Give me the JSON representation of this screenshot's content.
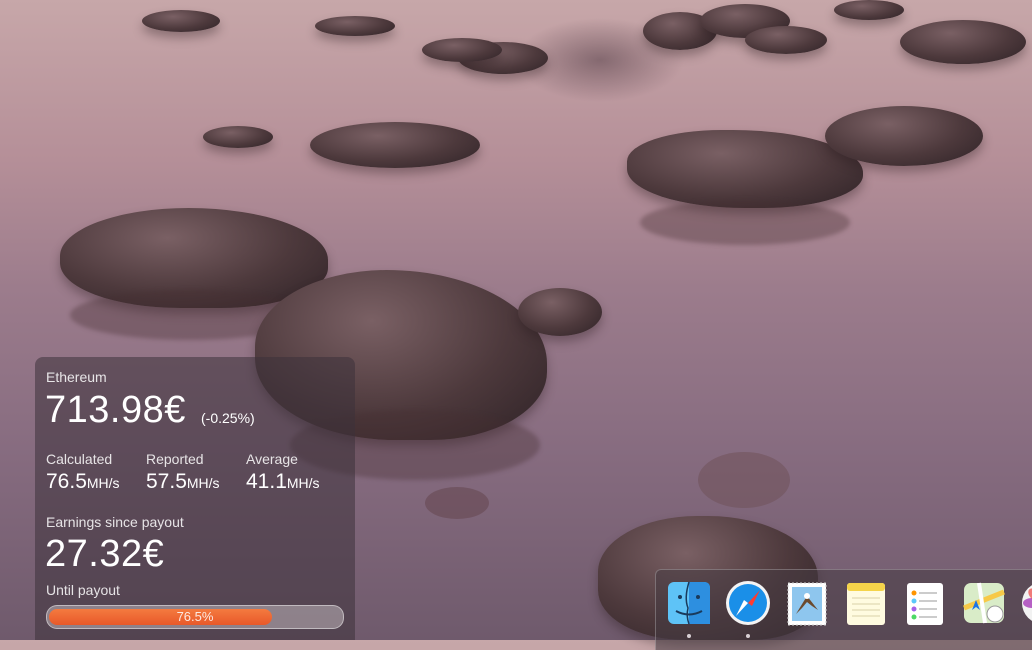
{
  "widget": {
    "coin_name": "Ethereum",
    "price": "713.98€",
    "price_change": "(-0.25%)",
    "metrics": [
      {
        "label": "Calculated",
        "value": "76.5",
        "unit": "MH/s"
      },
      {
        "label": "Reported",
        "value": "57.5",
        "unit": "MH/s"
      },
      {
        "label": "Average",
        "value": "41.1",
        "unit": "MH/s"
      }
    ],
    "earnings_label": "Earnings since payout",
    "earnings_value": "27.32€",
    "payout_label": "Until payout",
    "payout_progress_text": "76.5%",
    "payout_progress": 0.765
  },
  "dock": {
    "items": [
      {
        "name": "Finder",
        "icon": "finder-icon",
        "running": true
      },
      {
        "name": "Safari",
        "icon": "safari-icon",
        "running": true
      },
      {
        "name": "Mail",
        "icon": "mail-icon",
        "running": false
      },
      {
        "name": "Notes",
        "icon": "notes-icon",
        "running": false
      },
      {
        "name": "Reminders",
        "icon": "reminders-icon",
        "running": false
      },
      {
        "name": "Maps",
        "icon": "maps-icon",
        "running": false
      },
      {
        "name": "Photos",
        "icon": "photos-icon",
        "running": false
      }
    ]
  },
  "colors": {
    "progress_fill": "#e8592a",
    "widget_bg": "rgba(60,50,58,0.55)"
  }
}
